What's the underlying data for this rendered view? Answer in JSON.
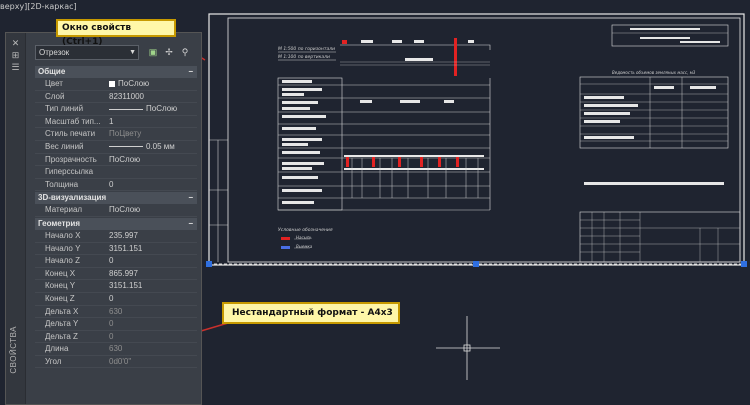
{
  "viewport": {
    "label": "верху][2D-каркас]"
  },
  "palette": {
    "strip_title": "СВОЙСТВА",
    "selected_object": "Отрезок",
    "sections": [
      {
        "title": "Общие",
        "rows": [
          {
            "name": "Цвет",
            "value": "ПоСлою",
            "kind": "swatch"
          },
          {
            "name": "Слой",
            "value": "82311000"
          },
          {
            "name": "Тип линий",
            "value": "ПоСлою",
            "kind": "linetype"
          },
          {
            "name": "Масштаб тип...",
            "value": "1"
          },
          {
            "name": "Стиль печати",
            "value": "ПоЦвету",
            "dim": true
          },
          {
            "name": "Вес линий",
            "value": "0.05 мм",
            "kind": "linetype"
          },
          {
            "name": "Прозрачность",
            "value": "ПоСлою"
          },
          {
            "name": "Гиперссылка",
            "value": ""
          },
          {
            "name": "Толщина",
            "value": "0"
          }
        ]
      },
      {
        "title": "3D-визуализация",
        "rows": [
          {
            "name": "Материал",
            "value": "ПоСлою"
          }
        ]
      },
      {
        "title": "Геометрия",
        "rows": [
          {
            "name": "Начало X",
            "value": "235.997"
          },
          {
            "name": "Начало Y",
            "value": "3151.151"
          },
          {
            "name": "Начало Z",
            "value": "0"
          },
          {
            "name": "Конец X",
            "value": "865.997"
          },
          {
            "name": "Конец Y",
            "value": "3151.151"
          },
          {
            "name": "Конец Z",
            "value": "0"
          },
          {
            "name": "Дельта X",
            "value": "630",
            "dim": true
          },
          {
            "name": "Дельта Y",
            "value": "0",
            "dim": true
          },
          {
            "name": "Дельта Z",
            "value": "0",
            "dim": true
          },
          {
            "name": "Длина",
            "value": "630",
            "dim": true
          },
          {
            "name": "Угол",
            "value": "0d0'0\"",
            "dim": true
          }
        ]
      }
    ]
  },
  "callouts": {
    "top": "Окно свойств (Ctrl+1)",
    "bottom": "Нестандартный формат - А4х3"
  },
  "drawing": {
    "note_line1": "М 1:500 по горизонтали",
    "note_line2": "М 1:100 по вертикали",
    "legend_title": "Условные обозначения",
    "legend_items": [
      "Насыпь",
      "Выемка"
    ],
    "table_title": "Ведомость объемов земляных масс, м3"
  },
  "colors": {
    "callout_bg": "#fff7a8",
    "grip": "#2f6fe0",
    "accent_red": "#e22222"
  }
}
